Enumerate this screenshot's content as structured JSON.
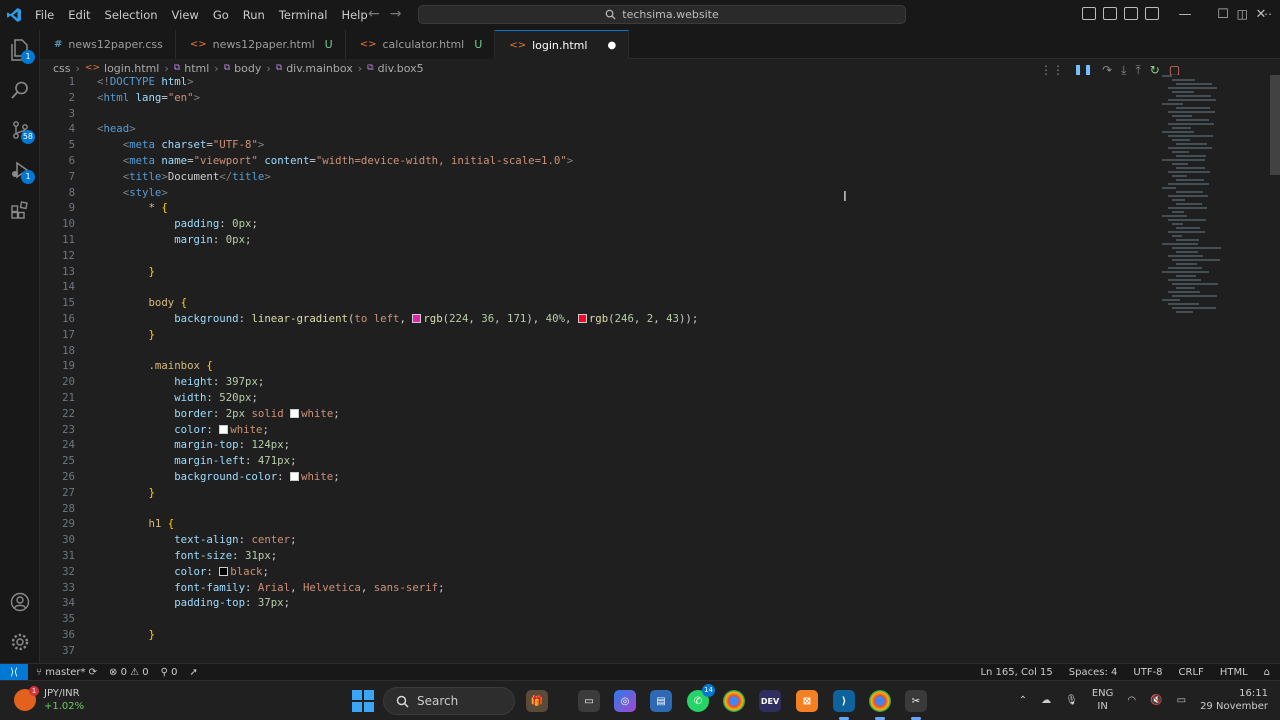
{
  "titlebar": {
    "menu": [
      "File",
      "Edit",
      "Selection",
      "View",
      "Go",
      "Run",
      "Terminal",
      "Help"
    ],
    "search_text": "techsima.website"
  },
  "activity": {
    "source_control_badge": "58",
    "run_badge": "1",
    "explorer_badge": "1"
  },
  "tabs": [
    {
      "label": "news12paper.css",
      "icon": "css",
      "status": "",
      "active": false
    },
    {
      "label": "news12paper.html",
      "icon": "html",
      "status": "U",
      "active": false
    },
    {
      "label": "calculator.html",
      "icon": "html",
      "status": "U",
      "active": false
    },
    {
      "label": "login.html",
      "icon": "html",
      "status": "●",
      "active": true
    }
  ],
  "breadcrumb": [
    "css",
    "login.html",
    "html",
    "body",
    "div.mainbox",
    "div.box5"
  ],
  "editor": {
    "lines": [
      [
        [
          "t-punc",
          "<!"
        ],
        [
          "t-tag",
          "DOCTYPE"
        ],
        [
          "t-text",
          " "
        ],
        [
          "t-attr",
          "html"
        ],
        [
          "t-punc",
          ">"
        ]
      ],
      [
        [
          "t-punc",
          "<"
        ],
        [
          "t-tag",
          "html"
        ],
        [
          "t-text",
          " "
        ],
        [
          "t-attr",
          "lang"
        ],
        [
          "t-text",
          "="
        ],
        [
          "t-str",
          "\"en\""
        ],
        [
          "t-punc",
          ">"
        ]
      ],
      [],
      [
        [
          "t-punc",
          "<"
        ],
        [
          "t-tag",
          "head"
        ],
        [
          "t-punc",
          ">"
        ]
      ],
      [
        [
          "t-text",
          "    "
        ],
        [
          "t-punc",
          "<"
        ],
        [
          "t-tag",
          "meta"
        ],
        [
          "t-text",
          " "
        ],
        [
          "t-attr",
          "charset"
        ],
        [
          "t-text",
          "="
        ],
        [
          "t-str",
          "\"UTF-8\""
        ],
        [
          "t-punc",
          ">"
        ]
      ],
      [
        [
          "t-text",
          "    "
        ],
        [
          "t-punc",
          "<"
        ],
        [
          "t-tag",
          "meta"
        ],
        [
          "t-text",
          " "
        ],
        [
          "t-attr",
          "name"
        ],
        [
          "t-text",
          "="
        ],
        [
          "t-str",
          "\"viewport\""
        ],
        [
          "t-text",
          " "
        ],
        [
          "t-attr",
          "content"
        ],
        [
          "t-text",
          "="
        ],
        [
          "t-str",
          "\"width=device-width, initial-scale=1.0\""
        ],
        [
          "t-punc",
          ">"
        ]
      ],
      [
        [
          "t-text",
          "    "
        ],
        [
          "t-punc",
          "<"
        ],
        [
          "t-tag",
          "title"
        ],
        [
          "t-punc",
          ">"
        ],
        [
          "t-text",
          "Document"
        ],
        [
          "t-punc",
          "</"
        ],
        [
          "t-tag",
          "title"
        ],
        [
          "t-punc",
          ">"
        ]
      ],
      [
        [
          "t-text",
          "    "
        ],
        [
          "t-punc",
          "<"
        ],
        [
          "t-tag",
          "style"
        ],
        [
          "t-punc",
          ">"
        ]
      ],
      [
        [
          "t-text",
          "        "
        ],
        [
          "t-sel",
          "*"
        ],
        [
          "t-text",
          " "
        ],
        [
          "t-brace",
          "{"
        ]
      ],
      [
        [
          "t-text",
          "            "
        ],
        [
          "t-prop",
          "padding"
        ],
        [
          "t-text",
          ": "
        ],
        [
          "t-num",
          "0px"
        ],
        [
          "t-text",
          ";"
        ]
      ],
      [
        [
          "t-text",
          "            "
        ],
        [
          "t-prop",
          "margin"
        ],
        [
          "t-text",
          ": "
        ],
        [
          "t-num",
          "0px"
        ],
        [
          "t-text",
          ";"
        ]
      ],
      [],
      [
        [
          "t-text",
          "        "
        ],
        [
          "t-brace",
          "}"
        ]
      ],
      [],
      [
        [
          "t-text",
          "        "
        ],
        [
          "t-sel",
          "body"
        ],
        [
          "t-text",
          " "
        ],
        [
          "t-brace",
          "{"
        ]
      ],
      [
        [
          "t-text",
          "            "
        ],
        [
          "t-prop",
          "background"
        ],
        [
          "t-text",
          ": "
        ],
        [
          "t-fn",
          "linear-gradient"
        ],
        [
          "t-text",
          "("
        ],
        [
          "t-val",
          "to left"
        ],
        [
          "t-text",
          ", "
        ],
        [
          "swatch",
          "#e024ab"
        ],
        [
          "t-fn",
          "rgb"
        ],
        [
          "t-text",
          "("
        ],
        [
          "t-num",
          "224"
        ],
        [
          "t-text",
          ", "
        ],
        [
          "t-num",
          "36"
        ],
        [
          "t-text",
          ", "
        ],
        [
          "t-num",
          "171"
        ],
        [
          "t-text",
          "), "
        ],
        [
          "t-num",
          "40%"
        ],
        [
          "t-text",
          ", "
        ],
        [
          "swatch",
          "#f6022b"
        ],
        [
          "t-fn",
          "rgb"
        ],
        [
          "t-text",
          "("
        ],
        [
          "t-num",
          "246"
        ],
        [
          "t-text",
          ", "
        ],
        [
          "t-num",
          "2"
        ],
        [
          "t-text",
          ", "
        ],
        [
          "t-num",
          "43"
        ],
        [
          "t-text",
          "));"
        ]
      ],
      [
        [
          "t-text",
          "        "
        ],
        [
          "t-brace",
          "}"
        ]
      ],
      [],
      [
        [
          "t-text",
          "        "
        ],
        [
          "t-sel",
          ".mainbox"
        ],
        [
          "t-text",
          " "
        ],
        [
          "t-brace",
          "{"
        ]
      ],
      [
        [
          "t-text",
          "            "
        ],
        [
          "t-prop",
          "height"
        ],
        [
          "t-text",
          ": "
        ],
        [
          "t-num",
          "397px"
        ],
        [
          "t-text",
          ";"
        ]
      ],
      [
        [
          "t-text",
          "            "
        ],
        [
          "t-prop",
          "width"
        ],
        [
          "t-text",
          ": "
        ],
        [
          "t-num",
          "520px"
        ],
        [
          "t-text",
          ";"
        ]
      ],
      [
        [
          "t-text",
          "            "
        ],
        [
          "t-prop",
          "border"
        ],
        [
          "t-text",
          ": "
        ],
        [
          "t-num",
          "2px"
        ],
        [
          "t-text",
          " "
        ],
        [
          "t-val",
          "solid"
        ],
        [
          "t-text",
          " "
        ],
        [
          "swatch",
          "#ffffff"
        ],
        [
          "t-val",
          "white"
        ],
        [
          "t-text",
          ";"
        ]
      ],
      [
        [
          "t-text",
          "            "
        ],
        [
          "t-prop",
          "color"
        ],
        [
          "t-text",
          ": "
        ],
        [
          "swatch",
          "#ffffff"
        ],
        [
          "t-val",
          "white"
        ],
        [
          "t-text",
          ";"
        ]
      ],
      [
        [
          "t-text",
          "            "
        ],
        [
          "t-prop",
          "margin-top"
        ],
        [
          "t-text",
          ": "
        ],
        [
          "t-num",
          "124px"
        ],
        [
          "t-text",
          ";"
        ]
      ],
      [
        [
          "t-text",
          "            "
        ],
        [
          "t-prop",
          "margin-left"
        ],
        [
          "t-text",
          ": "
        ],
        [
          "t-num",
          "471px"
        ],
        [
          "t-text",
          ";"
        ]
      ],
      [
        [
          "t-text",
          "            "
        ],
        [
          "t-prop",
          "background-color"
        ],
        [
          "t-text",
          ": "
        ],
        [
          "swatch",
          "#ffffff"
        ],
        [
          "t-val",
          "white"
        ],
        [
          "t-text",
          ";"
        ]
      ],
      [
        [
          "t-text",
          "        "
        ],
        [
          "t-brace",
          "}"
        ]
      ],
      [],
      [
        [
          "t-text",
          "        "
        ],
        [
          "t-sel",
          "h1"
        ],
        [
          "t-text",
          " "
        ],
        [
          "t-brace",
          "{"
        ]
      ],
      [
        [
          "t-text",
          "            "
        ],
        [
          "t-prop",
          "text-align"
        ],
        [
          "t-text",
          ": "
        ],
        [
          "t-val",
          "center"
        ],
        [
          "t-text",
          ";"
        ]
      ],
      [
        [
          "t-text",
          "            "
        ],
        [
          "t-prop",
          "font-size"
        ],
        [
          "t-text",
          ": "
        ],
        [
          "t-num",
          "31px"
        ],
        [
          "t-text",
          ";"
        ]
      ],
      [
        [
          "t-text",
          "            "
        ],
        [
          "t-prop",
          "color"
        ],
        [
          "t-text",
          ": "
        ],
        [
          "swatch",
          "#000000"
        ],
        [
          "t-val",
          "black"
        ],
        [
          "t-text",
          ";"
        ]
      ],
      [
        [
          "t-text",
          "            "
        ],
        [
          "t-prop",
          "font-family"
        ],
        [
          "t-text",
          ": "
        ],
        [
          "t-val",
          "Arial"
        ],
        [
          "t-text",
          ", "
        ],
        [
          "t-val",
          "Helvetica"
        ],
        [
          "t-text",
          ", "
        ],
        [
          "t-val",
          "sans-serif"
        ],
        [
          "t-text",
          ";"
        ]
      ],
      [
        [
          "t-text",
          "            "
        ],
        [
          "t-prop",
          "padding-top"
        ],
        [
          "t-text",
          ": "
        ],
        [
          "t-num",
          "37px"
        ],
        [
          "t-text",
          ";"
        ]
      ],
      [],
      [
        [
          "t-text",
          "        "
        ],
        [
          "t-brace",
          "}"
        ]
      ],
      []
    ]
  },
  "statusbar": {
    "branch": "master*",
    "errors": "0",
    "warnings": "0",
    "ports": "0",
    "position": "Ln 165, Col 15",
    "spaces": "Spaces: 4",
    "encoding": "UTF-8",
    "eol": "CRLF",
    "language": "HTML"
  },
  "taskbar": {
    "widget_title": "JPY/INR",
    "widget_change": "+1.02%",
    "widget_badge": "1",
    "search_label": "Search",
    "whatsapp_badge": "14",
    "lang_top": "ENG",
    "lang_bottom": "IN",
    "time": "16:11",
    "date": "29 November"
  }
}
